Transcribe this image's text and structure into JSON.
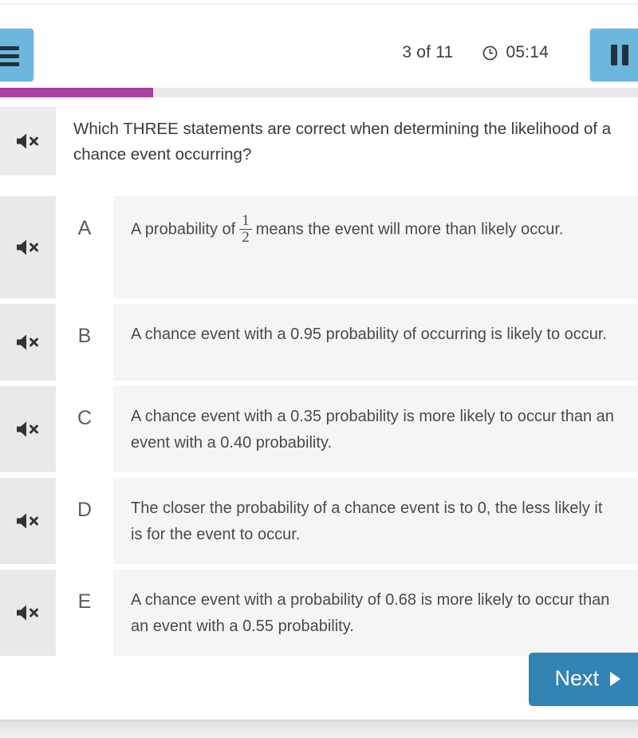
{
  "header": {
    "menu_icon": "hamburger-menu-icon",
    "progress_counter": "3 of 11",
    "clock_icon": "clock-icon",
    "timer": "05:14",
    "pause_icon": "pause-icon",
    "accent_blue": "#6cb7dd",
    "progress_percent": 24,
    "progress_color": "#a8419f"
  },
  "question": {
    "speaker_icon": "speaker-muted-icon",
    "text": "Which THREE statements are correct when determining the likelihood of a chance event occurring?"
  },
  "options": [
    {
      "letter": "A",
      "speaker_icon": "speaker-muted-icon",
      "text_before": "A probability of",
      "fraction_numerator": "1",
      "fraction_denominator": "2",
      "text_after": "means the event will more than likely occur."
    },
    {
      "letter": "B",
      "speaker_icon": "speaker-muted-icon",
      "text": "A chance event with a 0.95 probability of occurring is likely to occur."
    },
    {
      "letter": "C",
      "speaker_icon": "speaker-muted-icon",
      "text": "A chance event with a 0.35 probability is more likely to occur than an event with a 0.40 probability."
    },
    {
      "letter": "D",
      "speaker_icon": "speaker-muted-icon",
      "text": "The closer the probability of a chance event is to 0, the less likely it is for the event to occur."
    },
    {
      "letter": "E",
      "speaker_icon": "speaker-muted-icon",
      "text": "A chance event with a probability of 0.68 is more likely to occur than an event with a 0.55 probability."
    }
  ],
  "footer": {
    "next_label": "Next",
    "next_icon": "play-triangle-icon",
    "next_color": "#3184b4"
  }
}
